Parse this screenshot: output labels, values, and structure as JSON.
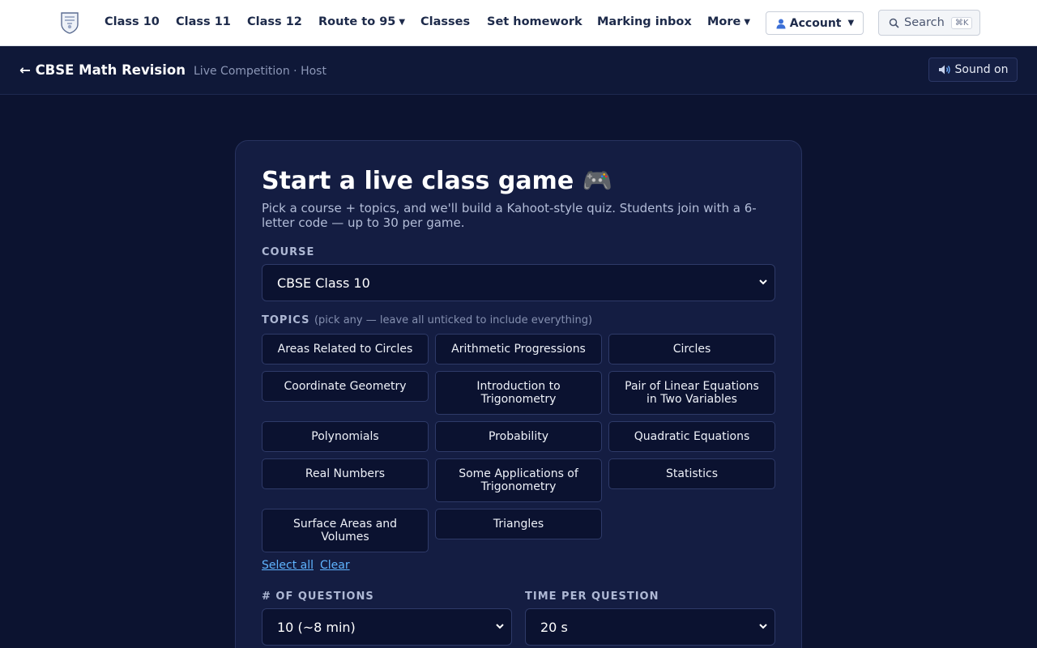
{
  "nav": {
    "links": [
      "Class 10",
      "Class 11",
      "Class 12",
      "Route to 95",
      "Classes",
      "Set homework",
      "Marking inbox",
      "More"
    ],
    "account_label": "Account",
    "account_icon": "user-icon",
    "search_label": "Search",
    "search_shortcut": "⌘K"
  },
  "subheader": {
    "back_label": "← CBSE Math Revision",
    "meta": "Live Competition · Host",
    "sound_label": "Sound on",
    "sound_icon": "speaker-icon"
  },
  "card": {
    "title": "Start a live class game 🎮",
    "subtitle": "Pick a course + topics, and we'll build a Kahoot-style quiz. Students join with a 6-letter code — up to 30 per game.",
    "course_label": "COURSE",
    "course_value": "CBSE Class 10",
    "topics_label": "TOPICS",
    "topics_hint": "(pick any — leave all unticked to include everything)",
    "topics": [
      "Areas Related to Circles",
      "Arithmetic Progressions",
      "Circles",
      "Coordinate Geometry",
      "Introduction to Trigonometry",
      "Pair of Linear Equations in Two Variables",
      "Polynomials",
      "Probability",
      "Quadratic Equations",
      "Real Numbers",
      "Some Applications of Trigonometry",
      "Statistics",
      "Surface Areas and Volumes",
      "Triangles"
    ],
    "select_all_label": "Select all",
    "clear_label": "Clear",
    "questions_label": "# OF QUESTIONS",
    "questions_value": "10 (~8 min)",
    "time_label": "TIME PER QUESTION",
    "time_value": "20 s"
  },
  "colors": {
    "background": "#0c1330",
    "card": "#141d42",
    "accent_link": "#5fb4ff",
    "nav_text": "#1d2a4a"
  }
}
